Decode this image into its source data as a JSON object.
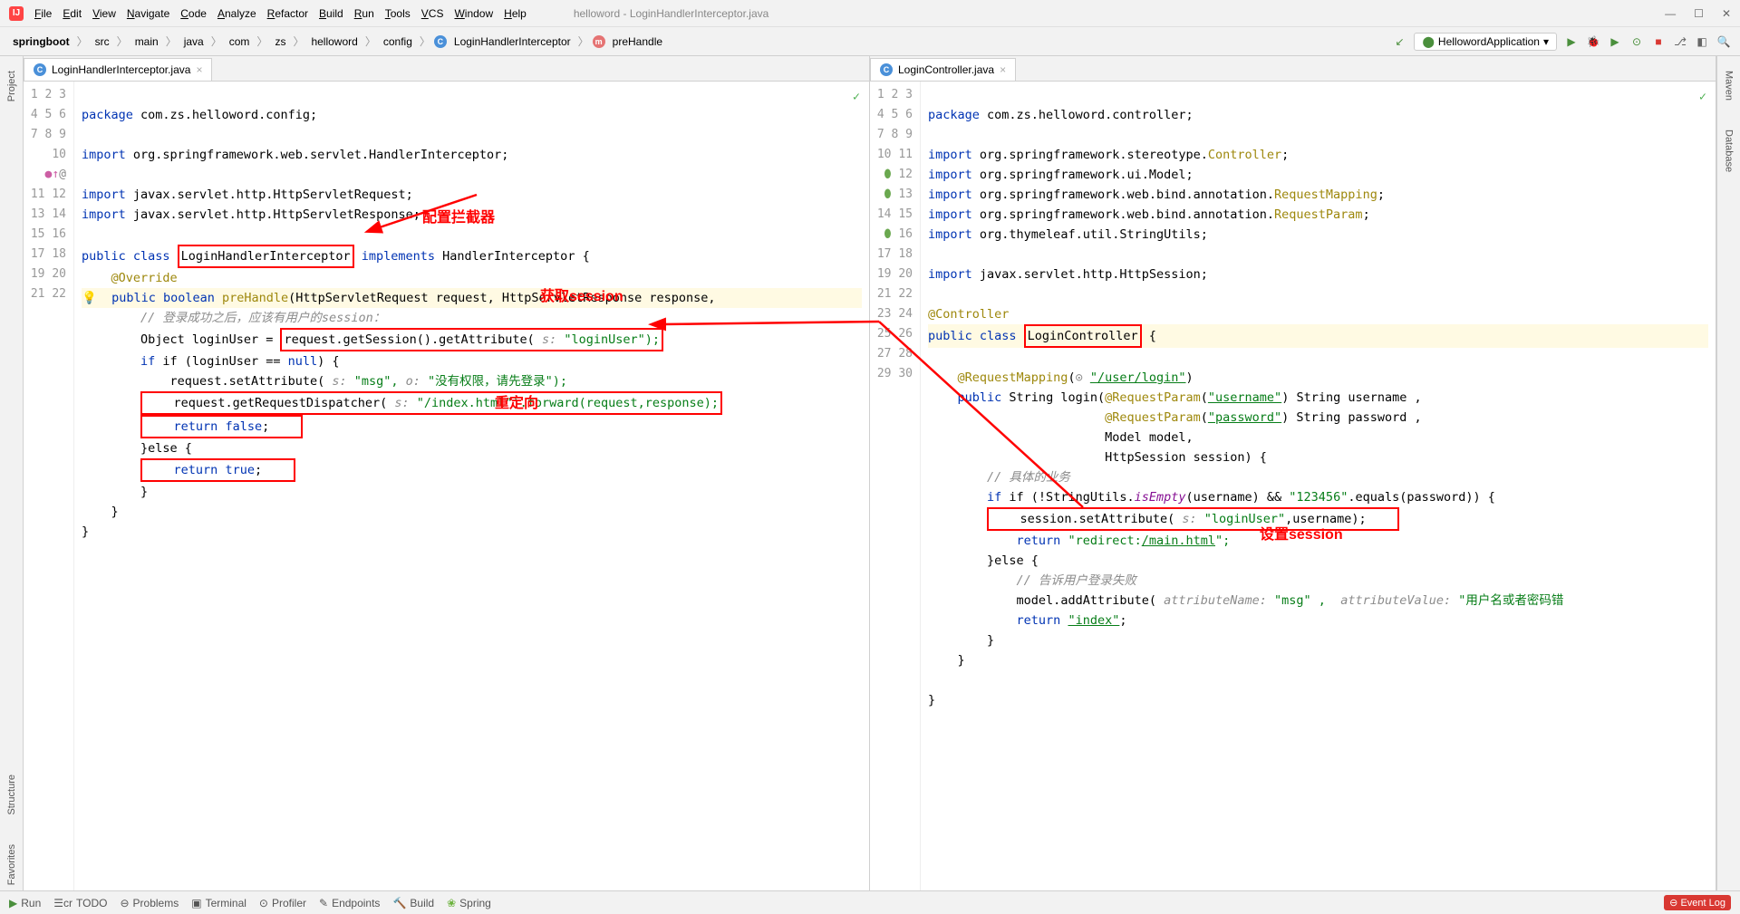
{
  "menubar": {
    "items": [
      "File",
      "Edit",
      "View",
      "Navigate",
      "Code",
      "Analyze",
      "Refactor",
      "Build",
      "Run",
      "Tools",
      "VCS",
      "Window",
      "Help"
    ],
    "title": "helloword - LoginHandlerInterceptor.java"
  },
  "breadcrumb": {
    "items": [
      "springboot",
      "src",
      "main",
      "java",
      "com",
      "zs",
      "helloword",
      "config",
      "LoginHandlerInterceptor",
      "preHandle"
    ]
  },
  "run_config": "HellowordApplication",
  "tabs": {
    "left": "LoginHandlerInterceptor.java",
    "right": "LoginController.java"
  },
  "sidebar_left": {
    "project": "Project",
    "structure": "Structure",
    "favorites": "Favorites"
  },
  "sidebar_right": {
    "maven": "Maven",
    "database": "Database"
  },
  "statusbar": {
    "run": "Run",
    "todo": "TODO",
    "problems": "Problems",
    "terminal": "Terminal",
    "profiler": "Profiler",
    "endpoints": "Endpoints",
    "build": "Build",
    "spring": "Spring",
    "event_log": "Event Log"
  },
  "annotations": {
    "cfg_interceptor": "配置拦截器",
    "get_session": "获取session",
    "redirect": "重定向",
    "set_session": "设置session"
  },
  "left_code": {
    "l1_pkg": "package",
    "l1_rest": " com.zs.helloword.config;",
    "l3_imp": "import",
    "l3_rest": " org.springframework.web.servlet.HandlerInterceptor;",
    "l5_rest": " javax.servlet.http.HttpServletRequest;",
    "l6_rest": " javax.servlet.http.HttpServletResponse;",
    "l8_pub": "public class ",
    "l8_name": "LoginHandlerInterceptor",
    "l8_impl": " implements",
    "l8_hi": " HandlerInterceptor {",
    "l9_ov": "@Override",
    "l10_sig": "public boolean ",
    "l10_m": "preHandle",
    "l10_args": "(HttpServletRequest request, HttpServletResponse response,",
    "l11_c1": "// 登录成功之后，应该有用户的session：",
    "l12_a": "Object loginUser = ",
    "l12_b": "request.getSession().getAttribute( ",
    "l12_s": "s:",
    "l12_c": " \"loginUser\");",
    "l13": "if (loginUser == ",
    "l13_null": "null",
    "l13_end": ") {",
    "l14_a": "request.setAttribute( ",
    "l14_s": "s:",
    "l14_msg": " \"msg\", ",
    "l14_o": "o:",
    "l14_txt": " \"没有权限，请先登录\");",
    "l15_a": "request.getRequestDispatcher( ",
    "l15_s": "s:",
    "l15_idx": " \"/index.html\").forward(request,response);",
    "l16": "return false",
    "l16_end": ";",
    "l17": "}else {",
    "l18": "return true",
    "l18_end": ";",
    "l19": "}",
    "l20": "}",
    "l21": "}"
  },
  "right_code": {
    "l1_rest": " com.zs.helloword.controller;",
    "l3_rest": " org.springframework.stereotype.",
    "l3_ctrl": "Controller",
    "l3_end": ";",
    "l4_rest": " org.springframework.ui.Model;",
    "l5_rest": " org.springframework.web.bind.annotation.",
    "l5_rm": "RequestMapping",
    "l5_end": ";",
    "l6_rest": " org.springframework.web.bind.annotation.",
    "l6_rp": "RequestParam",
    "l6_end": ";",
    "l7_rest": " org.thymeleaf.util.StringUtils;",
    "l9_rest": " javax.servlet.http.HttpSession;",
    "l11_ctrl": "@Controller",
    "l12_a": "public class ",
    "l12_name": "LoginController",
    "l12_end": " {",
    "l14_a": "@RequestMapping",
    "l14_b": "(",
    "l14_path": "\"/user/login\"",
    "l14_c": ")",
    "l15_a": "public",
    "l15_b": " String login(",
    "l15_rp": "@RequestParam",
    "l15_c": "(",
    "l15_un": "\"username\"",
    "l15_d": ") String username ,",
    "l16_rp": "@RequestParam",
    "l16_a": "(",
    "l16_pw": "\"password\"",
    "l16_b": ") String password ,",
    "l17": "Model model,",
    "l18": "HttpSession session) {",
    "l19_c": "// 具体的业务",
    "l20_a": "if (!StringUtils.",
    "l20_ie": "isEmpty",
    "l20_b": "(username) && ",
    "l20_pw": "\"123456\"",
    "l20_c": ".equals(password)) {",
    "l21_a": "session.setAttribute( ",
    "l21_s": "s:",
    "l21_lu": " \"loginUser\"",
    "l21_b": ",username);",
    "l22_a": "return ",
    "l22_b": "\"redirect:",
    "l22_m": "/main.html",
    "l22_c": "\";",
    "l23": "}else {",
    "l24_c": "// 告诉用户登录失败",
    "l25_a": "model.addAttribute( ",
    "l25_an": "attributeName:",
    "l25_msg": " \"msg\" ,  ",
    "l25_av": "attributeValue:",
    "l25_txt": " \"用户名或者密码错",
    "l26_a": "return ",
    "l26_idx": "\"index\"",
    "l26_b": ";",
    "l27": "}",
    "l28": "}",
    "l30": "}"
  }
}
